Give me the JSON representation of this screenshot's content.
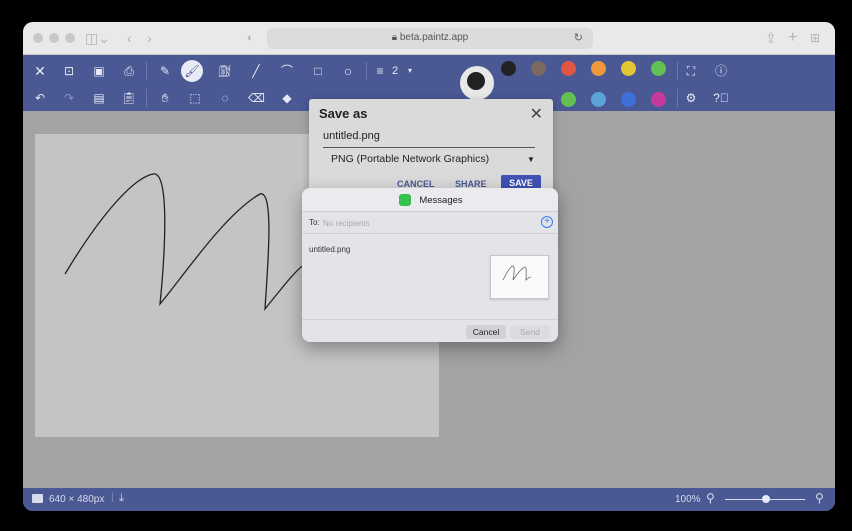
{
  "browser": {
    "url": "beta.paintz.app"
  },
  "toolbar": {
    "brush_size": "2",
    "colors": [
      "#222222",
      "#7b6a62",
      "#e05545",
      "#ee9a3a",
      "#e2c634",
      "#63c153",
      "#5ca4d8",
      "#3f6fd9",
      "#c53b9d"
    ]
  },
  "save_dialog": {
    "title": "Save as",
    "filename": "untitled.png",
    "file_type": "PNG (Portable Network Graphics)",
    "cancel_label": "CANCEL",
    "share_label": "SHARE",
    "save_label": "SAVE"
  },
  "messages_sheet": {
    "title": "Messages",
    "to_label": "To:",
    "to_placeholder": "No recipients",
    "attachment_name": "untitled.png",
    "cancel_label": "Cancel",
    "send_label": "Send"
  },
  "statusbar": {
    "dimensions": "640 × 480px",
    "zoom": "100%"
  }
}
